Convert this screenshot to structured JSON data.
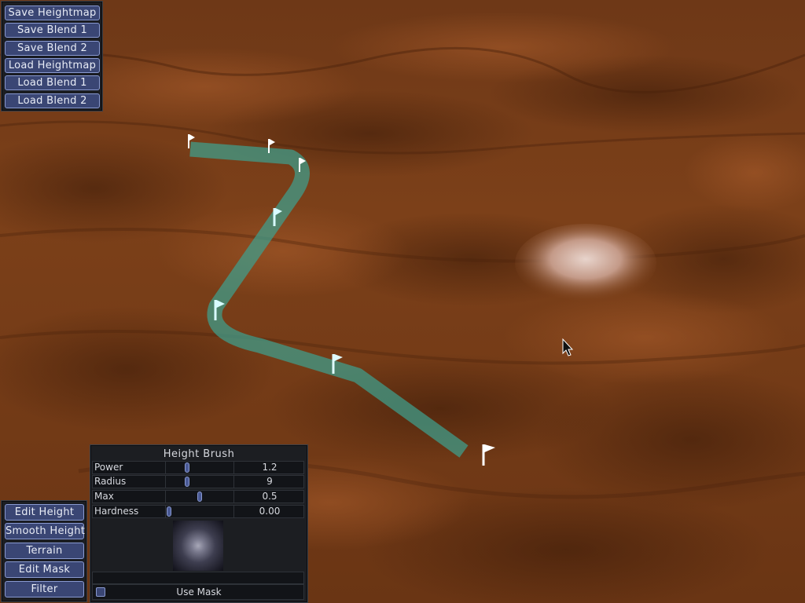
{
  "file_menu": {
    "buttons": [
      {
        "label": "Save Heightmap"
      },
      {
        "label": "Save Blend 1"
      },
      {
        "label": "Save Blend 2"
      },
      {
        "label": "Load Heightmap"
      },
      {
        "label": "Load Blend 1"
      },
      {
        "label": "Load Blend 2"
      }
    ]
  },
  "mode_menu": {
    "buttons": [
      {
        "label": "Edit Height"
      },
      {
        "label": "Smooth Height"
      },
      {
        "label": "Terrain"
      },
      {
        "label": "Edit Mask"
      },
      {
        "label": "Filter"
      }
    ]
  },
  "brush_panel": {
    "title": "Height Brush",
    "params": [
      {
        "label": "Power",
        "value": "1.2",
        "slider_fraction": 0.3
      },
      {
        "label": "Radius",
        "value": "9",
        "slider_fraction": 0.3
      },
      {
        "label": "Max",
        "value": "0.5",
        "slider_fraction": 0.5
      },
      {
        "label": "Hardness",
        "value": "0.00",
        "slider_fraction": 0.0
      }
    ],
    "use_mask": {
      "label": "Use Mask",
      "checked": false
    }
  },
  "scene": {
    "terrain_color": "#6a3514",
    "road_color": "#3fa08e",
    "flag_color": "#ffffff",
    "flag_count": 7
  }
}
